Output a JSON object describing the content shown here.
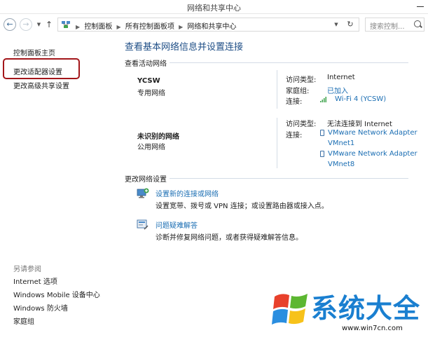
{
  "window": {
    "title": "网络和共享中心"
  },
  "navigation": {
    "back_icon": "arrow-left-icon",
    "forward_icon": "arrow-right-icon",
    "up_icon": "arrow-up-icon",
    "breadcrumbs": [
      "控制面板",
      "所有控制面板项",
      "网络和共享中心"
    ],
    "search_placeholder": "搜索控制..."
  },
  "sidebar": {
    "links": [
      "控制面板主页",
      "更改适配器设置",
      "更改高级共享设置"
    ],
    "see_also_label": "另请参阅",
    "see_also_links": [
      "Internet 选项",
      "Windows Mobile 设备中心",
      "Windows 防火墙",
      "家庭组"
    ]
  },
  "main": {
    "title": "查看基本网络信息并设置连接",
    "active_networks_heading": "查看活动网络",
    "networks": [
      {
        "name": "YCSW",
        "type": "专用网络",
        "access_label": "访问类型:",
        "access_value": "Internet",
        "homegroup_label": "家庭组:",
        "homegroup_value": "已加入",
        "connection_label": "连接:",
        "connection_value": "Wi-Fi 4 (YCSW)"
      },
      {
        "name": "未识别的网络",
        "type": "公用网络",
        "access_label": "访问类型:",
        "access_value": "无法连接到 Internet",
        "connection_label": "连接:",
        "adapters": [
          "VMware Network Adapter",
          "VMnet1",
          "VMware Network Adapter",
          "VMnet8"
        ]
      }
    ],
    "change_settings_heading": "更改网络设置",
    "tasks": [
      {
        "link": "设置新的连接或网络",
        "description": "设置宽带、拨号或 VPN 连接；或设置路由器或接入点。"
      },
      {
        "link": "问题疑难解答",
        "description": "诊断并修复网络问题，或者获得疑难解答信息。"
      }
    ]
  },
  "watermark": {
    "text": "系统大全",
    "url": "www.win7cn.com"
  },
  "colors": {
    "link": "#1b6eb3",
    "title": "#1e4e86",
    "highlight_box": "#a3161a",
    "watermark": "#1a7fd0"
  }
}
